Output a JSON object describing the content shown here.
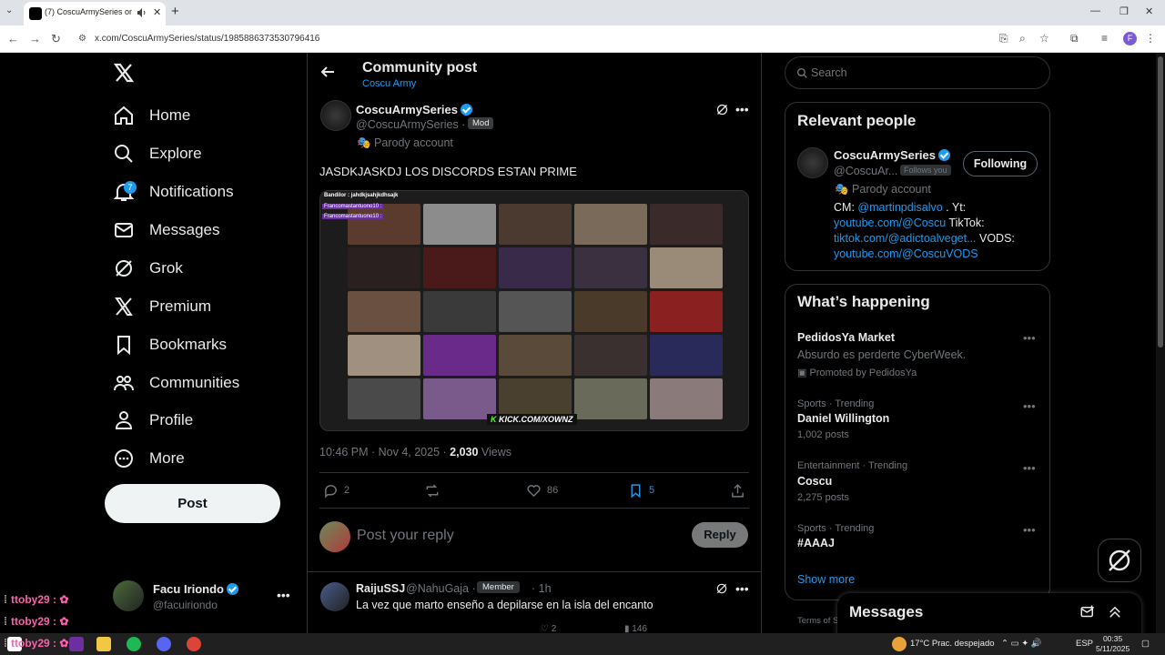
{
  "browser": {
    "tab_title": "(7) CoscuArmySeries on X:",
    "url": "x.com/CoscuArmySeries/status/1985886373530796416"
  },
  "nav": {
    "items": [
      {
        "label": "Home",
        "icon": "home-icon"
      },
      {
        "label": "Explore",
        "icon": "search-icon"
      },
      {
        "label": "Notifications",
        "icon": "bell-icon",
        "badge": "7"
      },
      {
        "label": "Messages",
        "icon": "envelope-icon"
      },
      {
        "label": "Grok",
        "icon": "grok-icon"
      },
      {
        "label": "Premium",
        "icon": "x-logo-icon"
      },
      {
        "label": "Bookmarks",
        "icon": "bookmark-icon"
      },
      {
        "label": "Communities",
        "icon": "people-icon"
      },
      {
        "label": "Profile",
        "icon": "person-icon"
      },
      {
        "label": "More",
        "icon": "more-circle-icon"
      }
    ],
    "post_button": "Post",
    "account": {
      "name": "Facu Iriondo",
      "handle": "@facuiriondo"
    }
  },
  "chat_overlay": [
    "ttoby29 :",
    "ttoby29 :",
    "ttoby29 :"
  ],
  "header": {
    "title": "Community post",
    "subtitle": "Coscu Army"
  },
  "post": {
    "author_name": "CoscuArmySeries",
    "author_handle": "@CoscuArmySeries ·",
    "mod_tag": "Mod",
    "parody": "Parody account",
    "text": "JASDKJASKDJ LOS DISCORDS ESTAN PRIME",
    "image_overlay": {
      "line1": "Bandilor : jahdkjsahjkdhsajk",
      "line2": "Francomastantuono10 :",
      "line3": "Francomastantuono10 :",
      "kick_prefix": "K",
      "kick_text": "KICK.COM/XOWNZ"
    },
    "timestamp": "10:46 PM · Nov 4, 2025 ·",
    "views_count": "2,030",
    "views_label": "Views",
    "replies": "2",
    "reposts": "",
    "likes": "86",
    "bookmarks": "5"
  },
  "reply_box": {
    "placeholder": "Post your reply",
    "button": "Reply"
  },
  "reply": {
    "name": "RaijuSSJ",
    "handle": "@NahuGaja ·",
    "tag": "Member",
    "time": "· 1h",
    "text": "La vez que marto enseño a depilarse en la isla del encanto",
    "likes": "2",
    "views": "146"
  },
  "right": {
    "search_placeholder": "Search",
    "relevant_title": "Relevant people",
    "person": {
      "name": "CoscuArmySeries",
      "handle": "@CoscuAr...",
      "follows_you": "Follows you",
      "button": "Following",
      "parody": "Parody account",
      "bio_1": "CM: ",
      "bio_link1": "@martinpdisalvo",
      "bio_2": " . Yt: ",
      "bio_link2": "youtube.com/@Coscu",
      "bio_3": " TikTok: ",
      "bio_link3": "tiktok.com/@adictoalveget...",
      "bio_4": " VODS: ",
      "bio_link4": "youtube.com/@CoscuVODS"
    },
    "happening_title": "What’s happening",
    "trends": [
      {
        "meta": "",
        "name": "PedidosYa Market",
        "desc": "Absurdo es perderte CyberWeek.",
        "extra": "Promoted by PedidosYa"
      },
      {
        "meta": "Sports · Trending",
        "name": "Daniel Willington",
        "desc": "1,002 posts"
      },
      {
        "meta": "Entertainment · Trending",
        "name": "Coscu",
        "desc": "2,275 posts"
      },
      {
        "meta": "Sports · Trending",
        "name": "#AAAJ",
        "desc": ""
      }
    ],
    "show_more": "Show more",
    "terms": "Terms of S",
    "messages_drawer": "Messages"
  },
  "taskbar": {
    "weather": "17°C  Prac. despejado",
    "lang": "ESP",
    "time": "00:35",
    "date": "5/11/2025"
  }
}
